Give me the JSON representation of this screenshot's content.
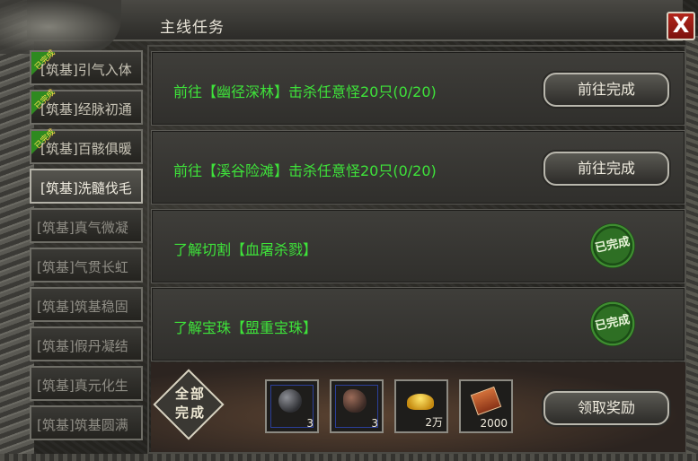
{
  "window": {
    "title": "主线任务",
    "close_label": "X"
  },
  "sidebar": {
    "done_tag": "已完成",
    "items": [
      {
        "label": "[筑基]引气入体",
        "state": "done"
      },
      {
        "label": "[筑基]经脉初通",
        "state": "done"
      },
      {
        "label": "[筑基]百骸俱暖",
        "state": "done"
      },
      {
        "label": "[筑基]洗髓伐毛",
        "state": "active"
      },
      {
        "label": "[筑基]真气微凝",
        "state": "locked"
      },
      {
        "label": "[筑基]气贯长虹",
        "state": "locked"
      },
      {
        "label": "[筑基]筑基稳固",
        "state": "locked"
      },
      {
        "label": "[筑基]假丹凝结",
        "state": "locked"
      },
      {
        "label": "[筑基]真元化生",
        "state": "locked"
      },
      {
        "label": "[筑基]筑基圆满",
        "state": "locked"
      }
    ]
  },
  "quests": [
    {
      "text": "前往【幽径深林】击杀任意怪20只(0/20)",
      "button": "前往完成"
    },
    {
      "text": "前往【溪谷险滩】击杀任意怪20只(0/20)",
      "button": "前往完成"
    },
    {
      "text": "了解切割【血屠杀戮】",
      "seal": "已完成"
    },
    {
      "text": "了解宝珠【盟重宝珠】",
      "seal": "已完成"
    }
  ],
  "rewards": {
    "badge_line1": "全部",
    "badge_line2": "完成",
    "items": [
      {
        "icon": "gray-gem-icon",
        "qty": "3"
      },
      {
        "icon": "red-gem-icon",
        "qty": "3"
      },
      {
        "icon": "gold-ingot-icon",
        "qty": "2万"
      },
      {
        "icon": "book-icon",
        "qty": "2000"
      }
    ],
    "claim_label": "领取奖励"
  },
  "colors": {
    "quest_text": "#3ee33a",
    "close_red": "#b3261c",
    "done_tag_green": "#2e8a1f",
    "seal_green": "#2e6f24"
  }
}
